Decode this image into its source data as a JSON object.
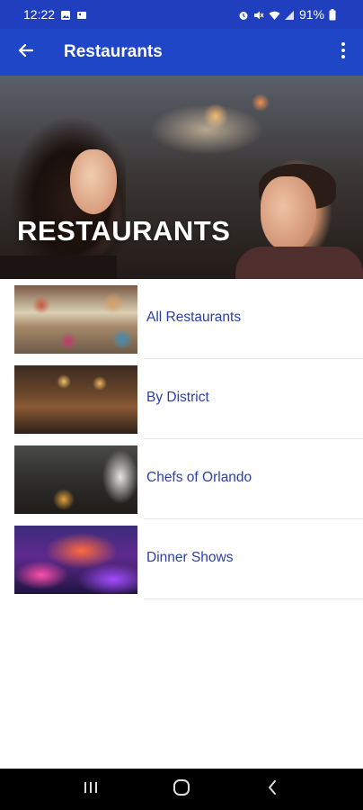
{
  "status_bar": {
    "time": "12:22",
    "battery": "91%"
  },
  "app_bar": {
    "title": "Restaurants"
  },
  "hero": {
    "title": "RESTAURANTS"
  },
  "list": {
    "items": [
      {
        "label": "All Restaurants"
      },
      {
        "label": "By District"
      },
      {
        "label": "Chefs of Orlando"
      },
      {
        "label": "Dinner Shows"
      }
    ]
  },
  "colors": {
    "app_bar": "#2046c8",
    "status_bar": "#1f3fbf",
    "link_text": "#2b3fa6"
  },
  "icons": [
    "arrow-left-icon",
    "more-vert-icon",
    "recents-icon",
    "home-icon",
    "back-icon"
  ]
}
